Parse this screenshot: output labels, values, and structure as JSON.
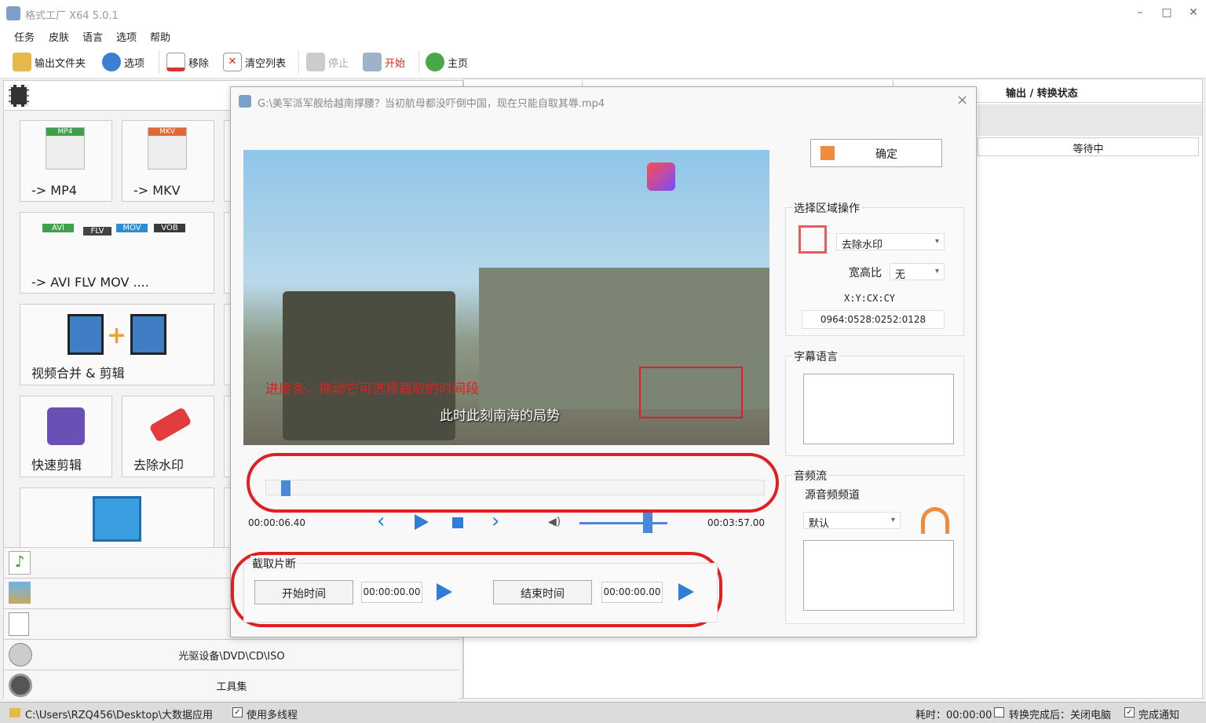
{
  "app": {
    "title": "格式工厂 X64 5.0.1"
  },
  "window_controls": {
    "minimize": "–",
    "maximize": "□",
    "close": "✕"
  },
  "menu": [
    "任务",
    "皮肤",
    "语言",
    "选项",
    "帮助"
  ],
  "toolbar": [
    {
      "label": "输出文件夹",
      "icon": "folder-icon"
    },
    {
      "label": "选项",
      "icon": "options-icon"
    },
    {
      "label": "移除",
      "icon": "remove-icon"
    },
    {
      "label": "清空列表",
      "icon": "clear-list-icon"
    },
    {
      "label": "停止",
      "icon": "stop-icon"
    },
    {
      "label": "开始",
      "icon": "start-icon"
    },
    {
      "label": "主页",
      "icon": "home-icon"
    }
  ],
  "left_panel": {
    "tiles": [
      {
        "label": "-> MP4",
        "badge": "MP4"
      },
      {
        "label": "-> MKV",
        "badge": "MKV"
      },
      {
        "label": "-> AVI FLV MOV ....",
        "badges": [
          "AVI",
          "FLV",
          "MOV",
          "VOB"
        ]
      },
      {
        "label": "视频合并 & 剪辑"
      },
      {
        "label": "快速剪辑"
      },
      {
        "label": "去除水印"
      }
    ],
    "categories": {
      "optical": "光驱设备\\DVD\\CD\\ISO",
      "tools": "工具集"
    }
  },
  "right_panel": {
    "header": "输出 / 转换状态",
    "status": "等待中"
  },
  "dialog": {
    "title": "G:\\美军派军舰给越南撑腰？当初航母都没吓倒中国，现在只能自取其辱.mp4",
    "close": "×",
    "video": {
      "subtitle": "此时此刻南海的局势",
      "annotation": "进度条，拖动它可选择截取的时间段"
    },
    "progress": {
      "value": 0.03
    },
    "time_current": "00:00:06.40",
    "time_total": "00:03:57.00",
    "volume": 0.78,
    "confirm_label": "确定",
    "select_region": {
      "title": "选择区域操作",
      "mode": "去除水印",
      "aspect_label": "宽高比",
      "aspect_value": "无",
      "coord_label": "X:Y:CX:CY",
      "coord_value": "0964:0528:0252:0128"
    },
    "subtitle_lang": {
      "title": "字幕语言"
    },
    "audio": {
      "title": "音频流",
      "source_label": "源音频频道",
      "source_value": "默认"
    },
    "clip": {
      "title": "截取片断",
      "start_button": "开始时间",
      "start_value": "00:00:00.00",
      "end_button": "结束时间",
      "end_value": "00:00:00.00"
    }
  },
  "status_bar": {
    "path": "C:\\Users\\RZQ456\\Desktop\\大数据应用",
    "multithread": "使用多线程",
    "elapsed": "耗时：00:00:00",
    "after_complete": "转换完成后：关闭电脑",
    "notify": "完成通知"
  },
  "colors": {
    "accent": "#2e7dd6",
    "annotation_red": "#e02020"
  }
}
